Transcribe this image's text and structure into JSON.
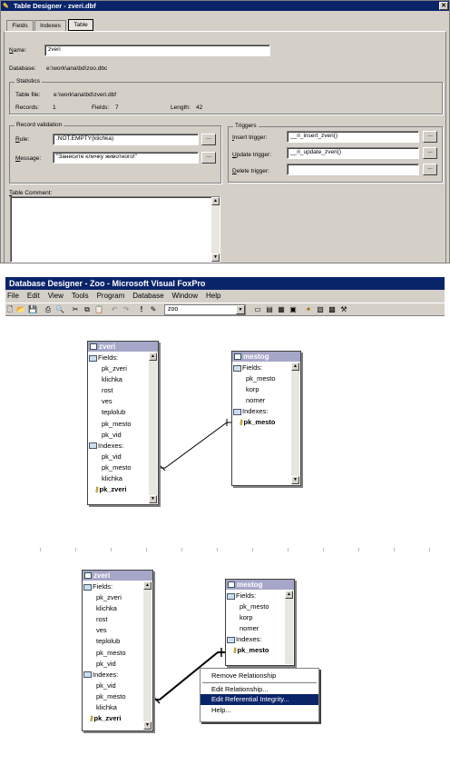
{
  "table_designer": {
    "title": "Table Designer - zveri.dbf",
    "tabs": [
      "Fields",
      "Indexes",
      "Table"
    ],
    "name_label": "Name:",
    "name_value": "zveri",
    "database_label": "Database:",
    "database_value": "e:\\work\\ana\\bd\\zoo.dbc",
    "statistics": {
      "title": "Statistics",
      "table_file_label": "Table file:",
      "table_file_value": "e:\\work\\ana\\bd\\zveri.dbf",
      "records_label": "Records:",
      "records_value": "1",
      "fields_label": "Fields:",
      "fields_value": "7",
      "length_label": "Length:",
      "length_value": "42"
    },
    "record_validation": {
      "title": "Record validation",
      "rule_label": "Rule:",
      "rule_value": ".NOT.EMPTY(klichka)",
      "message_label": "Message:",
      "message_value": "\"Занесите кличку животного!\""
    },
    "triggers": {
      "title": "Triggers",
      "insert_label": "Insert trigger:",
      "insert_value": "__ri_insert_zveri()",
      "update_label": "Update trigger:",
      "update_value": "__ri_update_zveri()",
      "delete_label": "Delete trigger:",
      "delete_value": ""
    },
    "comment_label": "Table Comment:",
    "ellipsis": "..."
  },
  "database_designer": {
    "title": "Database Designer - Zoo - Microsoft Visual FoxPro",
    "menu": [
      "File",
      "Edit",
      "View",
      "Tools",
      "Program",
      "Database",
      "Window",
      "Help"
    ],
    "toolbar_combo": "zoo"
  },
  "tables": {
    "zveri": {
      "name": "zveri",
      "fields_label": "Fields:",
      "fields": [
        "pk_zveri",
        "klichka",
        "rost",
        "ves",
        "teplolub",
        "pk_mesto",
        "pk_vid"
      ],
      "indexes_label": "Indexes:",
      "indexes": [
        "pk_vid",
        "pk_mesto",
        "klichka"
      ],
      "primary_key": "pk_zveri"
    },
    "mestog": {
      "name": "mestog",
      "fields_label": "Fields:",
      "fields": [
        "pk_mesto",
        "korp",
        "nomer"
      ],
      "indexes_label": "Indexes:",
      "primary_key": "pk_mesto"
    }
  },
  "context_menu": {
    "items": [
      "Remove Relationship",
      "Edit Relationship...",
      "Edit Referential Integrity...",
      "Help..."
    ],
    "selected": "Edit Referential Integrity..."
  }
}
